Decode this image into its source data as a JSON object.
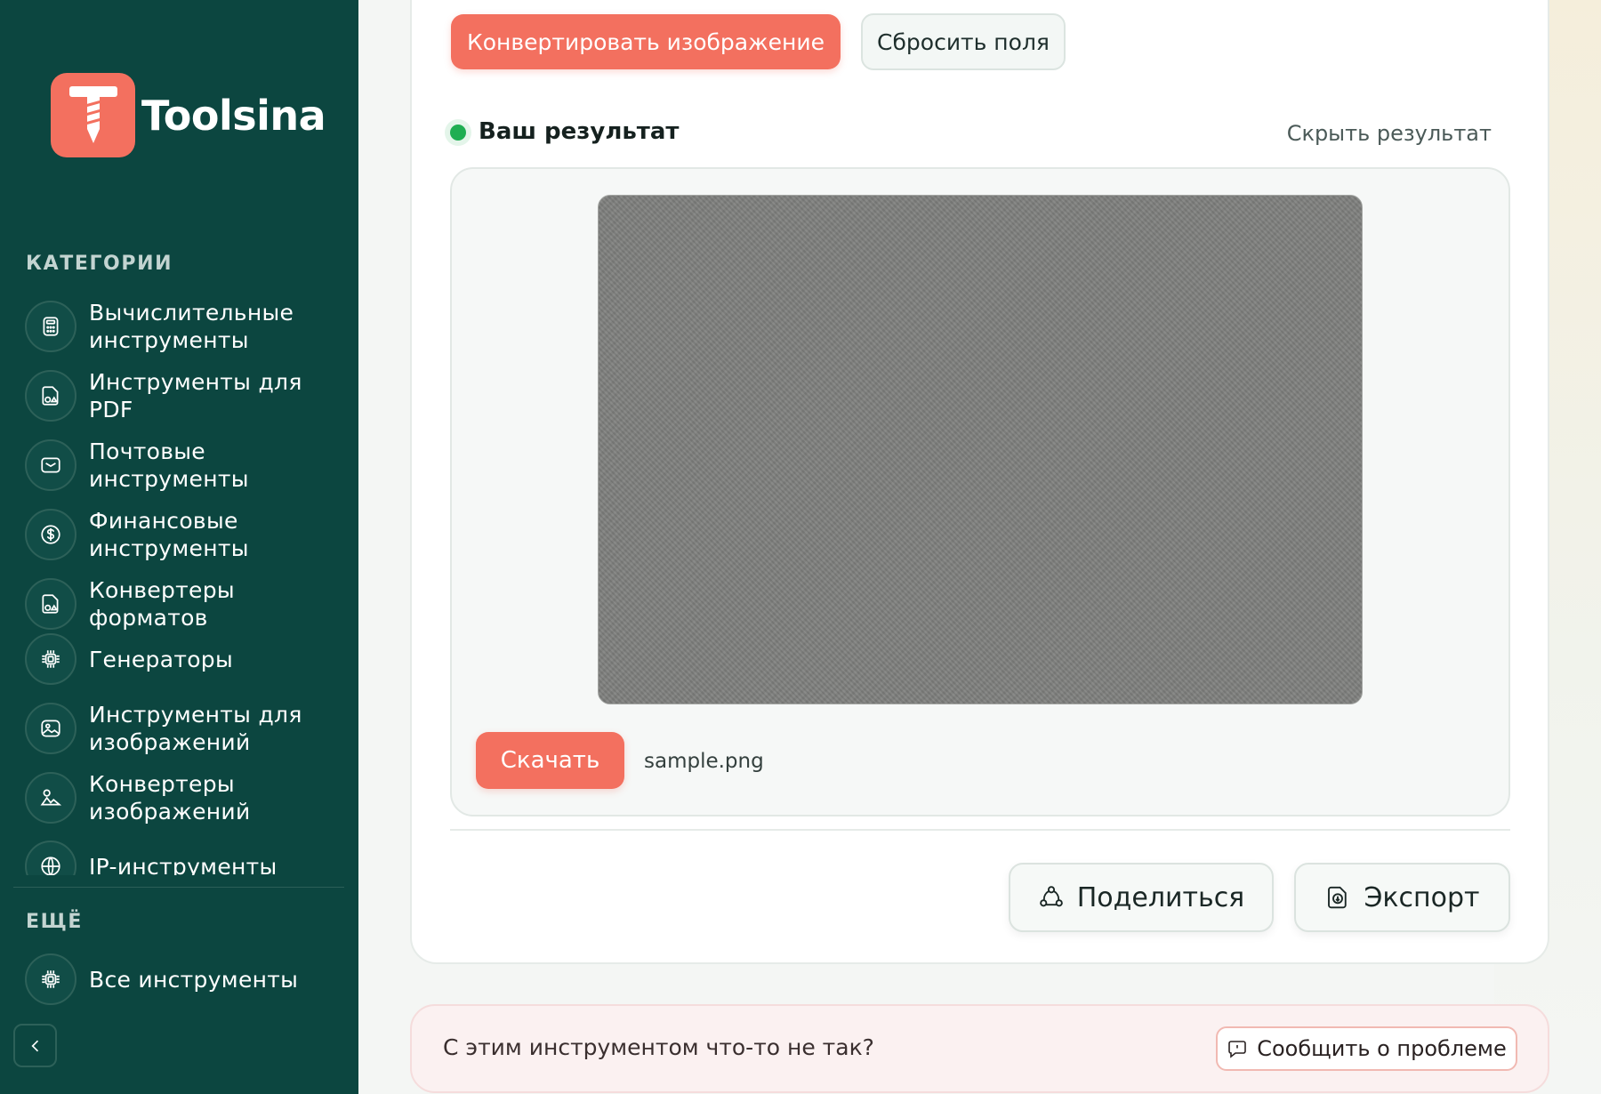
{
  "brand": {
    "name": "Toolsina",
    "accent": "#f3705f",
    "sidebar_bg": "#0c4640"
  },
  "sidebar": {
    "categories_label": "КАТЕГОРИИ",
    "items": [
      {
        "label": "Вычислительные инструменты",
        "icon": "calculator-icon"
      },
      {
        "label": "Инструменты для PDF",
        "icon": "file-shapes-icon"
      },
      {
        "label": "Почтовые инструменты",
        "icon": "mail-icon"
      },
      {
        "label": "Финансовые инструменты",
        "icon": "dollar-icon"
      },
      {
        "label": "Конвертеры форматов",
        "icon": "file-shapes-icon"
      },
      {
        "label": "Генераторы",
        "icon": "chip-icon"
      },
      {
        "label": "Инструменты для изображений",
        "icon": "image-icon"
      },
      {
        "label": "Конвертеры изображений",
        "icon": "shapes-icon"
      },
      {
        "label": "IP-инструменты",
        "icon": "globe-icon"
      }
    ],
    "more_label": "ЕЩЁ",
    "all_tools_label": "Все инструменты"
  },
  "toolbar": {
    "convert_label": "Конвертировать изображение",
    "reset_label": "Сбросить поля"
  },
  "result": {
    "title": "Ваш результат",
    "hide_label": "Скрыть результат",
    "download_label": "Скачать",
    "filename": "sample.png",
    "status_color": "#1fae52"
  },
  "actions": {
    "share_label": "Поделиться",
    "export_label": "Экспорт"
  },
  "report": {
    "question": "С этим инструментом что-то не так?",
    "button_label": "Сообщить о проблеме"
  }
}
